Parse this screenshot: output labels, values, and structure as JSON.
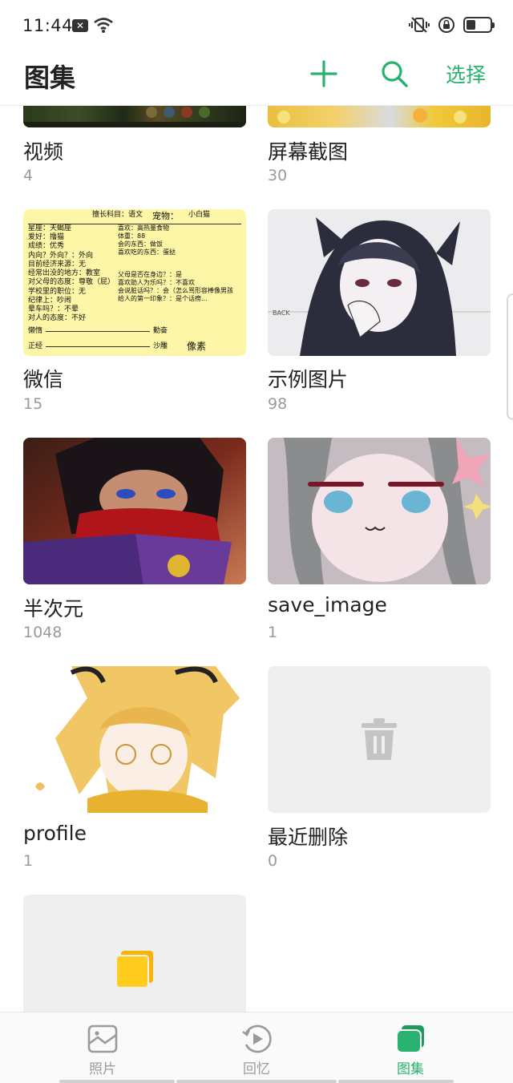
{
  "status_bar": {
    "time": "11:44",
    "battery_level": 0.4
  },
  "header": {
    "title": "图集",
    "select_label": "选择",
    "accent_color": "#28b26d"
  },
  "albums": [
    {
      "name": "视频",
      "count": "4"
    },
    {
      "name": "屏幕截图",
      "count": "30"
    },
    {
      "name": "微信",
      "count": "15"
    },
    {
      "name": "示例图片",
      "count": "98"
    },
    {
      "name": "半次元",
      "count": "1048"
    },
    {
      "name": "save_image",
      "count": "1"
    },
    {
      "name": "profile",
      "count": "1"
    },
    {
      "name": "最近删除",
      "count": "0"
    }
  ],
  "wechat_thumb_text": {
    "header_left": "擅长科目：语文",
    "header_right": "宠物：",
    "header_right2": "小白猫",
    "lines": [
      "星座：天蝎座",
      "爱好：撸猫",
      "成绩：优秀",
      "内向？外向？：外向",
      "目前经济来源：无",
      "经常出没的地方：教室",
      "对父母的态度：尊敬（屁）",
      "学校里的职位：无",
      "纪律上：吵闹",
      "晕车吗？：不晕",
      "对人的态度：不好"
    ],
    "right_lines": [
      "喜欢：高热量食物",
      "体重：88",
      "会的东西：做饭",
      "喜欢吃的东西：蛋挞",
      "父母是否在身边？：是",
      "喜欢助人为乐吗？：不喜欢",
      "会说脏话吗？：会（怎么骂形容棒像男孩",
      "给人的第一印象？：是个话痨..."
    ],
    "scale1_left": "懒惰",
    "scale1_right": "勤奋",
    "scale2_left": "正经",
    "scale2_right": "沙雕",
    "footer": "像素"
  },
  "example_thumb_text": "BACK",
  "bottom_nav": [
    {
      "label": "照片",
      "active": false
    },
    {
      "label": "回忆",
      "active": false
    },
    {
      "label": "图集",
      "active": true
    }
  ]
}
